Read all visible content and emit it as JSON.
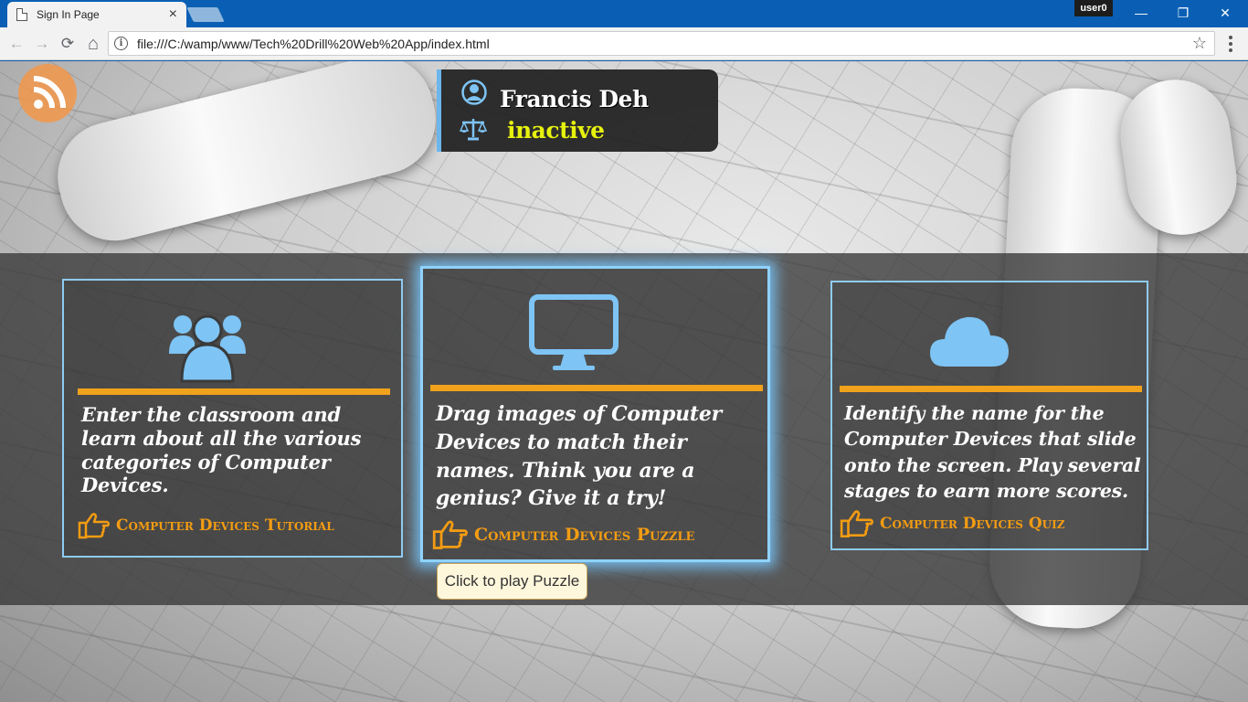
{
  "browser": {
    "tab_title": "Sign In Page",
    "tab_close": "×",
    "user_label": "user0",
    "minimize": "—",
    "restore": "❐",
    "close": "✕",
    "back": "←",
    "forward": "→",
    "reload": "⟳",
    "home": "⌂",
    "info": "i",
    "url": "file:///C:/wamp/www/Tech%20Drill%20Web%20App/index.html",
    "star": "☆"
  },
  "profile": {
    "name": "Francis Deh",
    "status": "inactive"
  },
  "cards": [
    {
      "icon": "users-icon",
      "description": "Enter the classroom and learn about all the various categories of Computer Devices.",
      "link": "Computer Devices Tutorial"
    },
    {
      "icon": "monitor-icon",
      "description": "Drag images of Computer Devices to match their names. Think you are a genius? Give it a try!",
      "link": "Computer Devices Puzzle"
    },
    {
      "icon": "cloud-icon",
      "description": "Identify the name for the Computer Devices that slide onto the screen. Play several stages to earn more scores.",
      "link": "Computer Devices Quiz"
    }
  ],
  "tooltip": "Click to play Puzzle",
  "colors": {
    "accent_orange": "#f0a21c",
    "link_orange": "#f39c12",
    "icon_blue": "#7ec4f5",
    "status_yellow": "#e6f20e",
    "chrome_blue": "#0a5fb4"
  }
}
